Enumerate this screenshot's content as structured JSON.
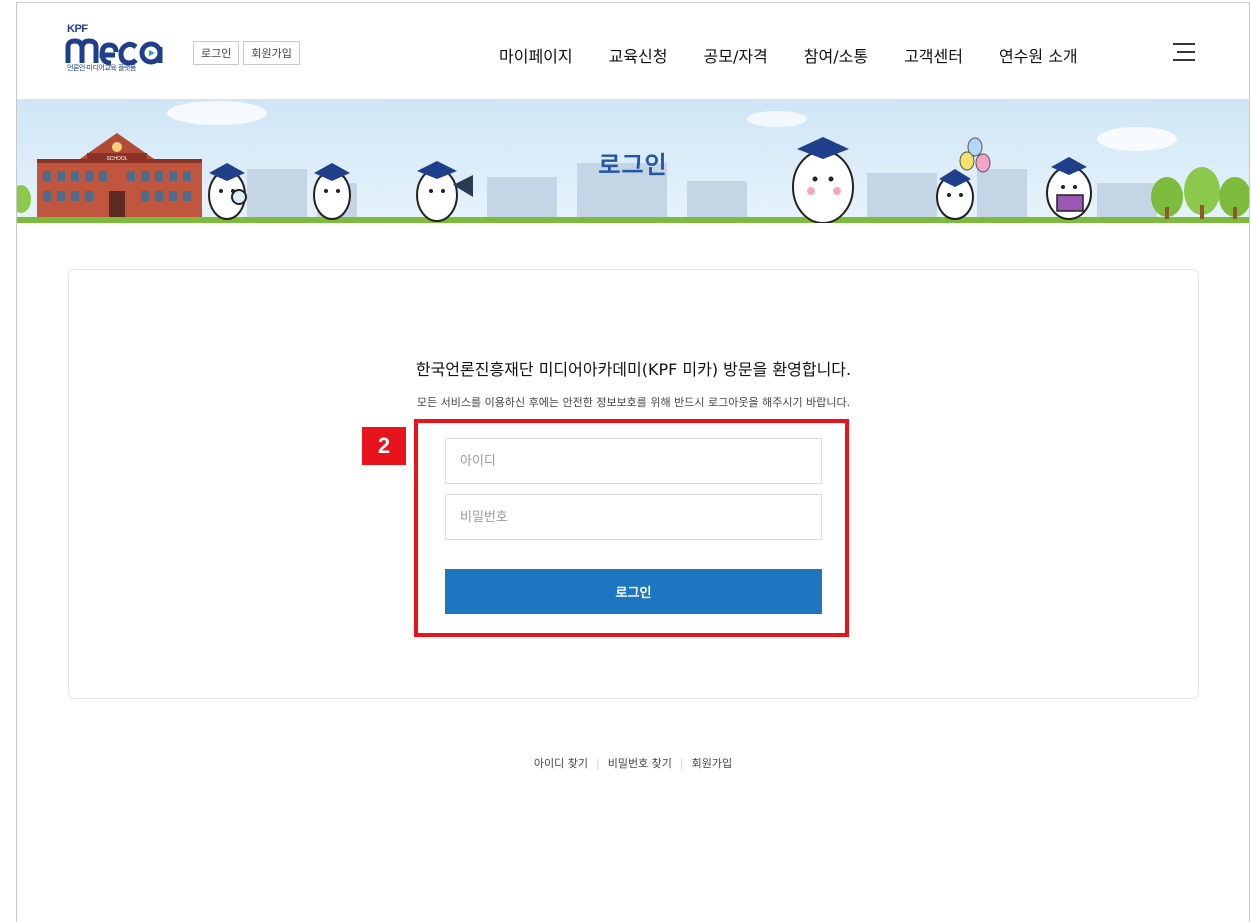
{
  "header": {
    "logo_kpf": "KPF",
    "logo_main": "meca",
    "logo_sub": "언론인·미디어교육 플랫폼",
    "util": [
      {
        "label": "로그인"
      },
      {
        "label": "회원가입"
      }
    ],
    "nav": [
      {
        "label": "마이페이지"
      },
      {
        "label": "교육신청"
      },
      {
        "label": "공모/자격"
      },
      {
        "label": "참여/소통"
      },
      {
        "label": "고객센터"
      },
      {
        "label": "연수원 소개"
      }
    ],
    "menu_icon": "hamburger-menu-icon"
  },
  "banner": {
    "title": "로그인",
    "school_sign": "SCHOOL"
  },
  "login": {
    "welcome": "한국언론진흥재단 미디어아카데미(KPF 미카) 방문을 환영합니다.",
    "notice": "모든 서비스를 이용하신 후에는 안전한 정보보호를 위해 반드시 로그아웃을 해주시기 바랍니다.",
    "id_placeholder": "아이디",
    "password_placeholder": "비밀번호",
    "submit_label": "로그인"
  },
  "annotation": {
    "badge": "2",
    "color": "#e8141c"
  },
  "footer": {
    "links": [
      {
        "label": "아이디 찾기"
      },
      {
        "label": "비밀번호 찾기"
      },
      {
        "label": "회원가입"
      }
    ]
  },
  "colors": {
    "primary": "#1c76c0",
    "title_blue": "#2456a4",
    "logo_navy": "#1f3f8a"
  }
}
